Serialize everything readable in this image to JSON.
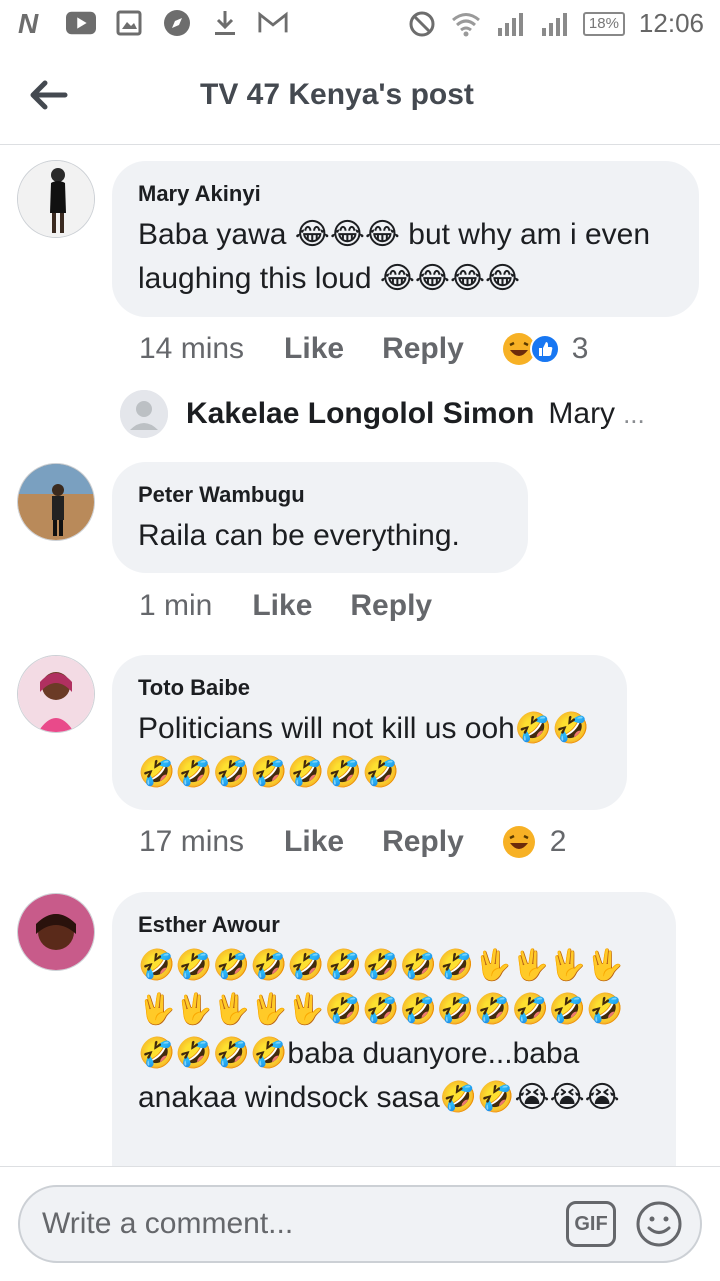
{
  "status_bar": {
    "time": "12:06",
    "battery": "18%",
    "left_icons": [
      "notification-n-icon",
      "youtube-icon",
      "gallery-icon",
      "compass-icon",
      "download-icon",
      "gmail-icon"
    ],
    "right_icons": [
      "dnd-icon",
      "wifi-icon",
      "signal-icon",
      "signal-2-icon"
    ]
  },
  "header": {
    "title": "TV 47 Kenya's post",
    "back_icon": "arrow-left-icon"
  },
  "comments": [
    {
      "author": "Mary Akinyi",
      "text": "Baba yawa 😂😂😂 but why am i even laughing this loud 😂😂😂😂",
      "time": "14 mins",
      "like": "Like",
      "reply": "Reply",
      "reactions": [
        "haha",
        "like"
      ],
      "reaction_count": "3"
    },
    {
      "author": "Peter Wambugu",
      "text": "Raila can be everything.",
      "time": "1 min",
      "like": "Like",
      "reply": "Reply"
    },
    {
      "author": "Toto Baibe",
      "text": "Politicians will not kill us ooh🤣🤣🤣🤣🤣🤣🤣🤣🤣",
      "time": "17 mins",
      "like": "Like",
      "reply": "Reply",
      "reactions": [
        "haha"
      ],
      "reaction_count": "2"
    },
    {
      "author": "Esther Awour",
      "text": "🤣🤣🤣🤣🤣🤣🤣🤣🤣🖖🖖🖖🖖🖖🖖🖖🖖🖖🤣🤣🤣🤣🤣🤣🤣🤣🤣🤣🤣🤣baba duanyore...baba anakaa windsock sasa🤣🤣😭😭😭"
    }
  ],
  "reply_preview": {
    "name": "Kakelae Longolol Simon",
    "text": "Mary",
    "ellipsis": "..."
  },
  "composer": {
    "placeholder": "Write a comment...",
    "gif_label": "GIF",
    "emoji_icon": "smiley-icon"
  },
  "colors": {
    "bubble": "#f0f2f5",
    "meta_text": "#65676b",
    "like_blue": "#1877f2",
    "haha_yellow": "#f7b125"
  }
}
